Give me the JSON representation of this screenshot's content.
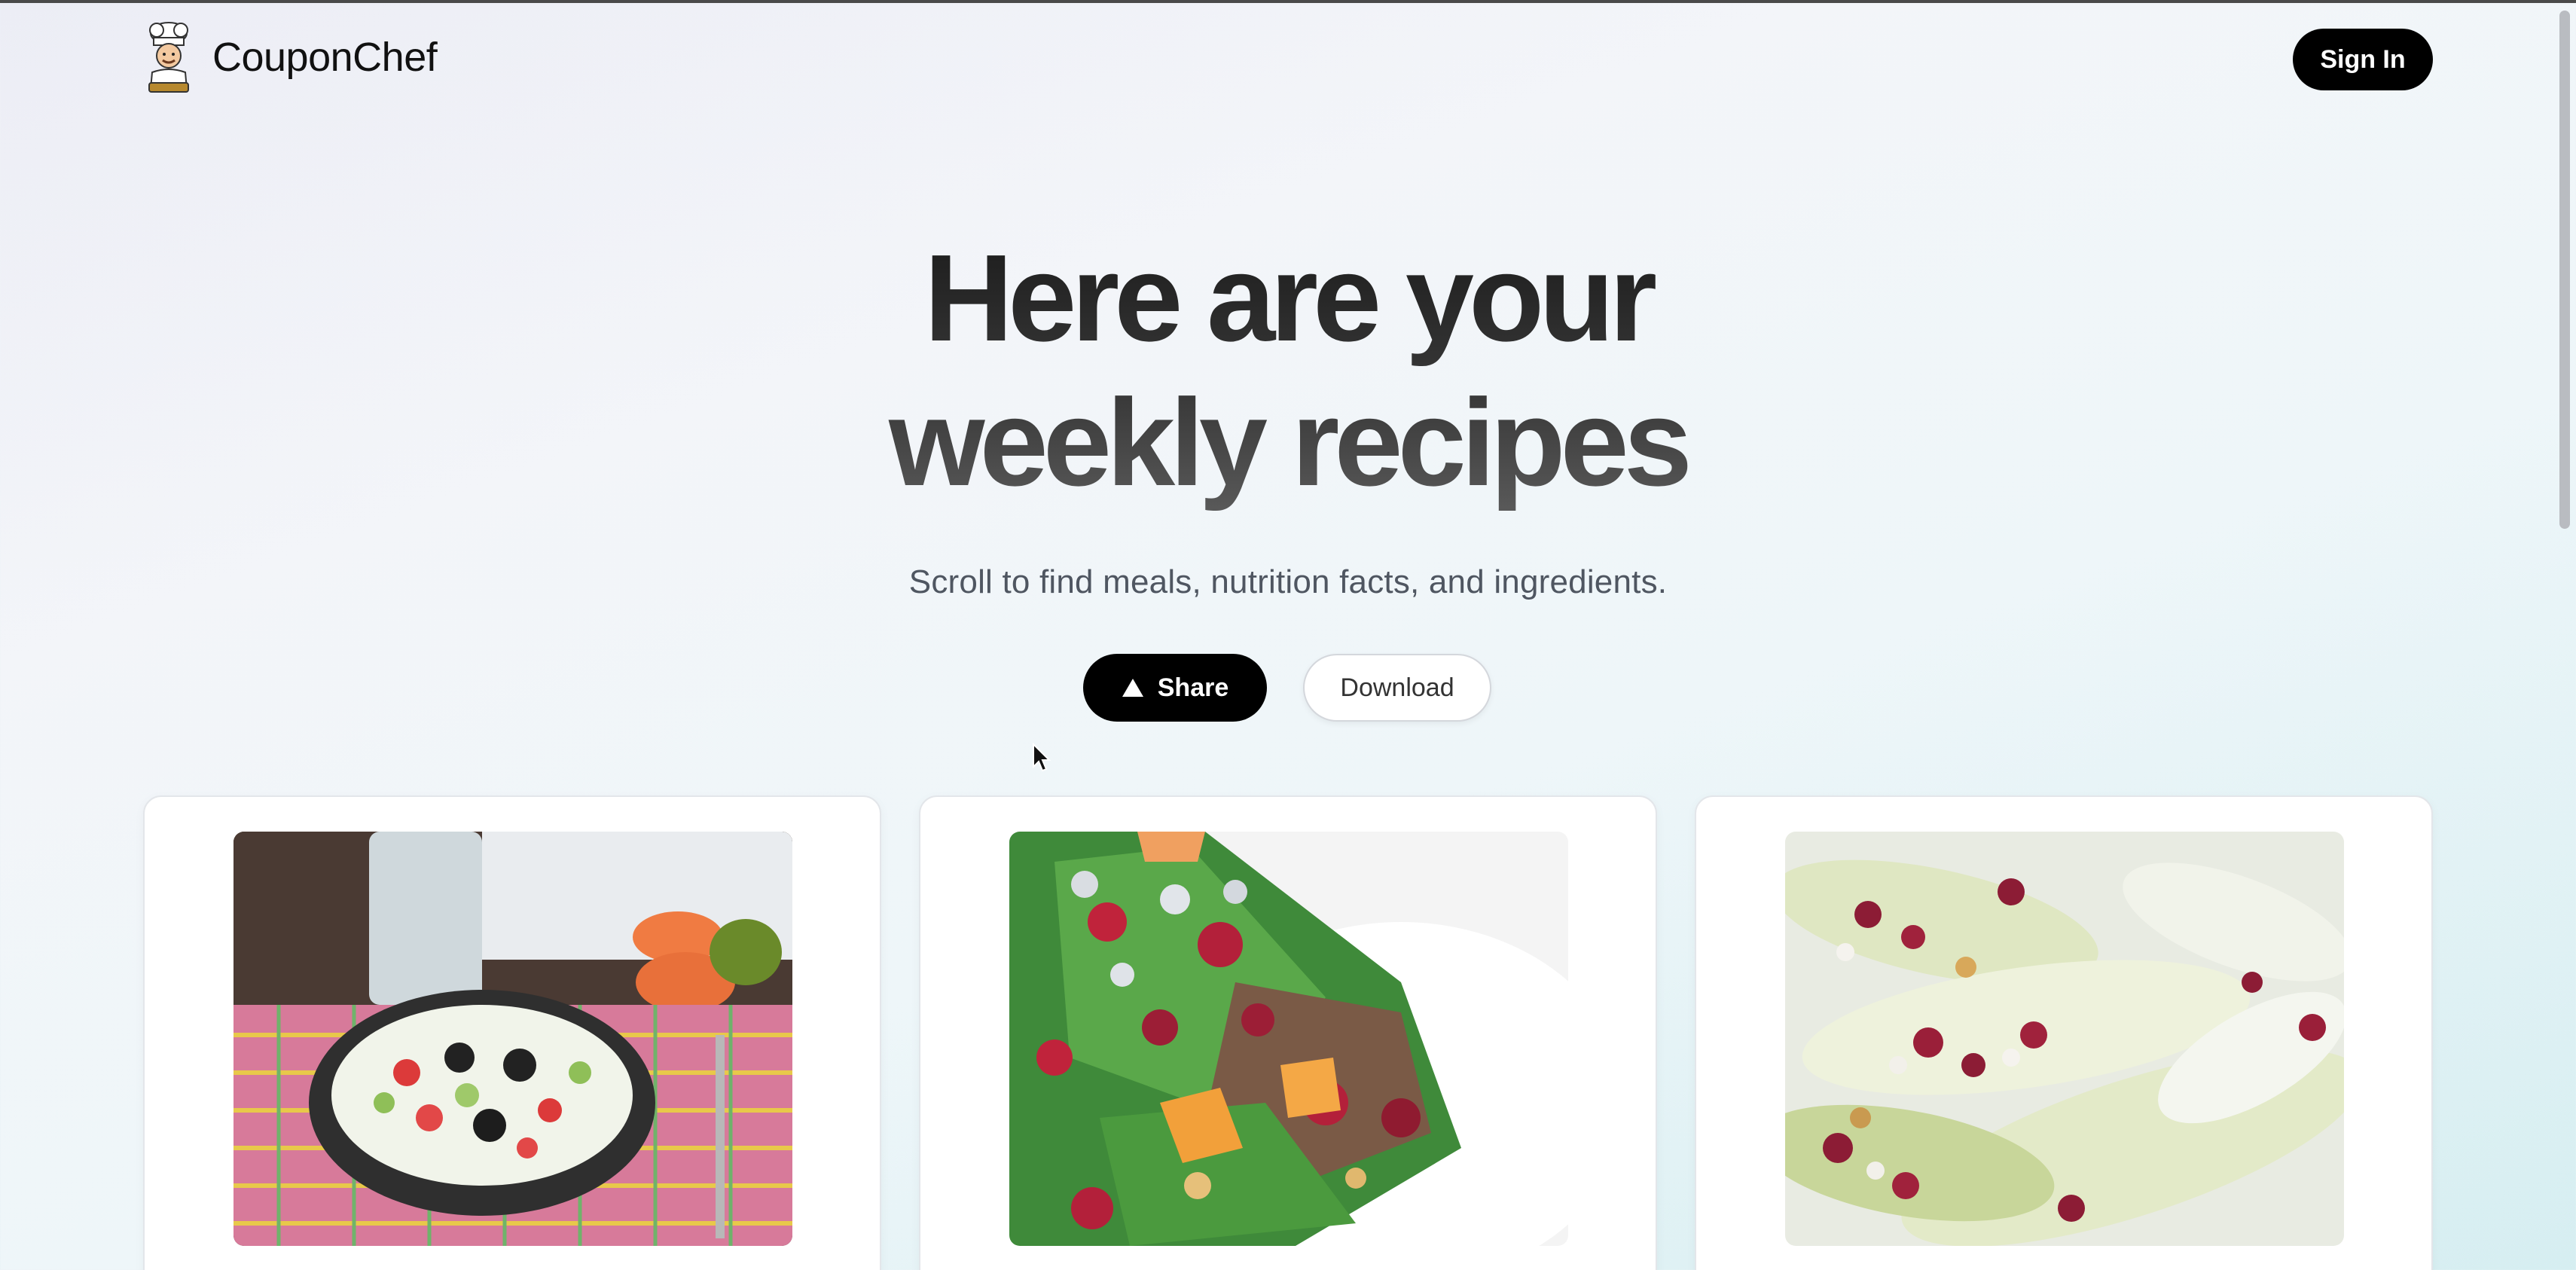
{
  "brand": {
    "name": "CouponChef",
    "logo_icon": "chef-mascot-icon"
  },
  "header": {
    "signin_label": "Sign In"
  },
  "hero": {
    "title_line1": "Here are your",
    "title_line2": "weekly recipes",
    "subtitle": "Scroll to find meals, nutrition facts, and ingredients."
  },
  "actions": {
    "share_label": "Share",
    "share_icon": "triangle-up-icon",
    "download_label": "Download"
  },
  "recipes": [
    {
      "image_icon": "fruit-salad-bowl-image"
    },
    {
      "image_icon": "cranberry-green-salad-image"
    },
    {
      "image_icon": "endive-cranberry-boats-image"
    }
  ],
  "colors": {
    "primary_button": "#000000",
    "background_start": "#ecedf5",
    "background_end": "#d6eef1"
  }
}
